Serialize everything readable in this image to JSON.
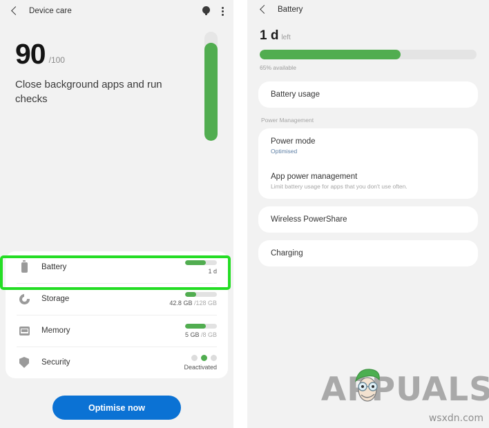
{
  "left_panel": {
    "appbar": {
      "title": "Device care",
      "back_icon": "back-chevron-icon",
      "tips_icon": "lightbulb-icon",
      "overflow_icon": "kebab-menu-icon"
    },
    "hero": {
      "score": "90",
      "score_denominator": "/100",
      "message": "Close background apps and run checks",
      "gauge_percent": 90
    },
    "status_items": [
      {
        "icon": "battery-icon",
        "label": "Battery",
        "value": "1 d",
        "value_dim": "",
        "bar_percent": 65,
        "type": "bar"
      },
      {
        "icon": "storage-icon",
        "label": "Storage",
        "value": "42.8 GB",
        "value_dim": "/128 GB",
        "bar_percent": 34,
        "type": "bar"
      },
      {
        "icon": "memory-icon",
        "label": "Memory",
        "value": "5 GB",
        "value_dim": "/8 GB",
        "bar_percent": 66,
        "type": "bar"
      },
      {
        "icon": "shield-icon",
        "label": "Security",
        "value": "Deactivated",
        "value_dim": "",
        "bar_percent": 0,
        "type": "dots"
      }
    ],
    "optimise_button": "Optimise now"
  },
  "right_panel": {
    "appbar": {
      "title": "Battery",
      "back_icon": "back-chevron-icon"
    },
    "hero": {
      "time_remaining": "1 d",
      "time_label": "left",
      "battery_percent": 65,
      "available_caption": "65% available"
    },
    "items": [
      {
        "title": "Battery usage",
        "subtitle": ""
      },
      {
        "title": "Power mode",
        "subtitle": "Optimised"
      },
      {
        "title": "App power management",
        "subtitle": "Limit battery usage for apps that you don't use often."
      },
      {
        "title": "Wireless PowerShare",
        "subtitle": ""
      },
      {
        "title": "Charging",
        "subtitle": ""
      }
    ],
    "section_label": "Power Management"
  },
  "watermark": {
    "brand": "APPUALS",
    "domain": "wsxdn.com"
  },
  "colors": {
    "green": "#51ad50",
    "highlight_green": "#24dd24",
    "blue_button": "#0b72d4",
    "link_blue": "#5d7fa5",
    "panel_bg": "#f2f2f2",
    "card_bg": "#ffffff"
  }
}
